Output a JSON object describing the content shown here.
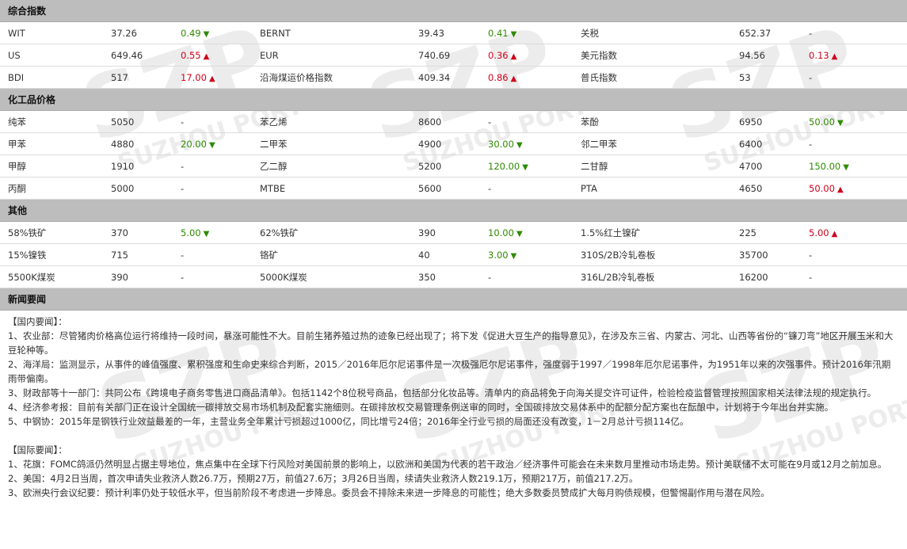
{
  "sections": [
    {
      "title": "综合指数",
      "rows": [
        [
          {
            "name": "WIT",
            "price": "37.26",
            "change": "0.49",
            "dir": "down"
          },
          {
            "name": "BERNT",
            "price": "39.43",
            "change": "0.41",
            "dir": "down"
          },
          {
            "name": "关税",
            "price": "652.37",
            "change": "-",
            "dir": ""
          }
        ],
        [
          {
            "name": "US",
            "price": "649.46",
            "change": "0.55",
            "dir": "up"
          },
          {
            "name": "EUR",
            "price": "740.69",
            "change": "0.36",
            "dir": "up"
          },
          {
            "name": "美元指数",
            "price": "94.56",
            "change": "0.13",
            "dir": "up"
          }
        ],
        [
          {
            "name": "BDI",
            "price": "517",
            "change": "17.00",
            "dir": "up"
          },
          {
            "name": "沿海煤运价格指数",
            "price": "409.34",
            "change": "0.86",
            "dir": "up"
          },
          {
            "name": "普氏指数",
            "price": "53",
            "change": "-",
            "dir": ""
          }
        ]
      ]
    },
    {
      "title": "化工品价格",
      "rows": [
        [
          {
            "name": "纯苯",
            "price": "5050",
            "change": "-",
            "dir": ""
          },
          {
            "name": "苯乙烯",
            "price": "8600",
            "change": "-",
            "dir": ""
          },
          {
            "name": "苯酚",
            "price": "6950",
            "change": "50.00",
            "dir": "down"
          }
        ],
        [
          {
            "name": "甲苯",
            "price": "4880",
            "change": "20.00",
            "dir": "down"
          },
          {
            "name": "二甲苯",
            "price": "4900",
            "change": "30.00",
            "dir": "down"
          },
          {
            "name": "邻二甲苯",
            "price": "6400",
            "change": "-",
            "dir": ""
          }
        ],
        [
          {
            "name": "甲醇",
            "price": "1910",
            "change": "-",
            "dir": ""
          },
          {
            "name": "乙二醇",
            "price": "5200",
            "change": "120.00",
            "dir": "down"
          },
          {
            "name": "二甘醇",
            "price": "4700",
            "change": "150.00",
            "dir": "down"
          }
        ],
        [
          {
            "name": "丙酮",
            "price": "5000",
            "change": "-",
            "dir": ""
          },
          {
            "name": "MTBE",
            "price": "5600",
            "change": "-",
            "dir": ""
          },
          {
            "name": "PTA",
            "price": "4650",
            "change": "50.00",
            "dir": "up"
          }
        ]
      ]
    },
    {
      "title": "其他",
      "rows": [
        [
          {
            "name": "58%铁矿",
            "price": "370",
            "change": "5.00",
            "dir": "down"
          },
          {
            "name": "62%铁矿",
            "price": "390",
            "change": "10.00",
            "dir": "down"
          },
          {
            "name": "1.5%红土镍矿",
            "price": "225",
            "change": "5.00",
            "dir": "up"
          }
        ],
        [
          {
            "name": "15%镍铁",
            "price": "715",
            "change": "-",
            "dir": ""
          },
          {
            "name": "铬矿",
            "price": "40",
            "change": "3.00",
            "dir": "down"
          },
          {
            "name": "310S/2B冷轧卷板",
            "price": "35700",
            "change": "-",
            "dir": ""
          }
        ],
        [
          {
            "name": "5500K煤炭",
            "price": "390",
            "change": "-",
            "dir": ""
          },
          {
            "name": "5000K煤炭",
            "price": "350",
            "change": "-",
            "dir": ""
          },
          {
            "name": "316L/2B冷轧卷板",
            "price": "16200",
            "change": "-",
            "dir": ""
          }
        ]
      ]
    }
  ],
  "news": {
    "title": "新闻要闻",
    "domestic_heading": "【国内要闻】：",
    "domestic": [
      "1、农业部：尽管猪肉价格高位运行将维持一段时间，暴涨可能性不大。目前生猪养殖过热的迹象已经出现了；将下发《促进大豆生产的指导意见》，在涉及东三省、内蒙古、河北、山西等省份的“镰刀弯”地区开展玉米和大豆轮种等。",
      "2、海洋局：监测显示，从事件的峰值强度、累积强度和生命史来综合判断，2015／2016年厄尔尼诺事件是一次极强厄尔尼诺事件，强度弱于1997／1998年厄尔尼诺事件，为1951年以来的次强事件。预计2016年汛期雨带偏南。",
      "3、财政部等十一部门：共同公布《跨境电子商务零售进口商品清单》。包括1142个8位税号商品，包括部分化妆品等。清单内的商品将免于向海关提交许可证件，检验检疫监督管理按照国家相关法律法规的规定执行。",
      "4、经济参考报：目前有关部门正在设计全国统一碳排放交易市场机制及配套实施细则。在碳排放权交易管理条例送审的同时，全国碳排放交易体系中的配额分配方案也在酝酿中，计划将于今年出台并实施。",
      "5、中钢协：2015年是钢铁行业效益最差的一年，主营业务全年累计亏损超过1000亿，同比增亏24倍；2016年全行业亏损的局面还没有改变，1－2月总计亏损114亿。"
    ],
    "international_heading": "【国际要闻】：",
    "international": [
      "1、花旗：FOMC鸽派仍然明显占据主导地位，焦点集中在全球下行风险对美国前景的影响上，以欧洲和美国为代表的若干政治／经济事件可能会在未来数月里推动市场走势。预计美联储不太可能在9月或12月之前加息。",
      "2、美国：4月2日当周，首次申请失业救济人数26.7万，预期27万，前值27.6万；3月26日当周，续请失业救济人数219.1万，预期217万，前值217.2万。",
      "3、欧洲央行会议纪要：预计利率仍处于较低水平，但当前阶段不考虑进一步降息。委员会不排除未来进一步降息的可能性；绝大多数委员赞成扩大每月购债规模，但警惕副作用与潜在风险。"
    ]
  },
  "watermark_text": "SUZHOU PORT",
  "watermark_mark": "SZP",
  "colors": {
    "up": "#d0021b",
    "down": "#2e8b00",
    "header_bg": "#bdbdbd"
  }
}
